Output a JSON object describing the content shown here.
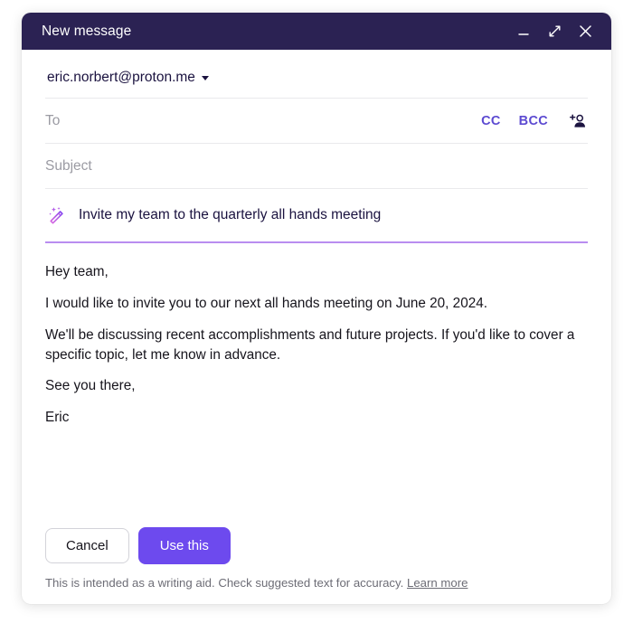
{
  "window": {
    "title": "New message",
    "controls": [
      {
        "name": "minimize-button",
        "icon": "minimize-icon"
      },
      {
        "name": "maximize-button",
        "icon": "expand-icon"
      },
      {
        "name": "close-button",
        "icon": "close-icon"
      }
    ]
  },
  "compose": {
    "sender": {
      "address": "eric.norbert@proton.me",
      "dropdown_icon": "chevron-down-icon"
    },
    "to": {
      "placeholder": "To",
      "value": "",
      "cc_label": "CC",
      "bcc_label": "BCC",
      "contact_icon": "add-contact-icon"
    },
    "subject": {
      "placeholder": "Subject",
      "value": ""
    },
    "prompt": {
      "icon": "magic-wand-icon",
      "value": "Invite my team to the quarterly all hands meeting",
      "placeholder": "Invite my team to the quarterly all hands meeting",
      "underline_color": "#b98df0"
    },
    "message": {
      "paragraphs": [
        "Hey team,",
        "I would like to invite you to our next all hands meeting on June 20, 2024.",
        "We'll be discussing recent accomplishments and future projects. If you'd like to cover a specific topic, let me know in advance.",
        "See you there,",
        "Eric"
      ]
    }
  },
  "footer": {
    "cancel_label": "Cancel",
    "use_this_label": "Use this",
    "disclaimer_text": "This is intended as a writing aid. Check suggested text for accuracy.",
    "learn_more_label": "Learn more"
  },
  "colors": {
    "titlebar": "#2b2253",
    "accent_purple": "#6d4aee",
    "link_purple": "#5c4ad1",
    "prompt_underline": "#b98df0",
    "placeholder_gray": "#9b9ba3"
  }
}
